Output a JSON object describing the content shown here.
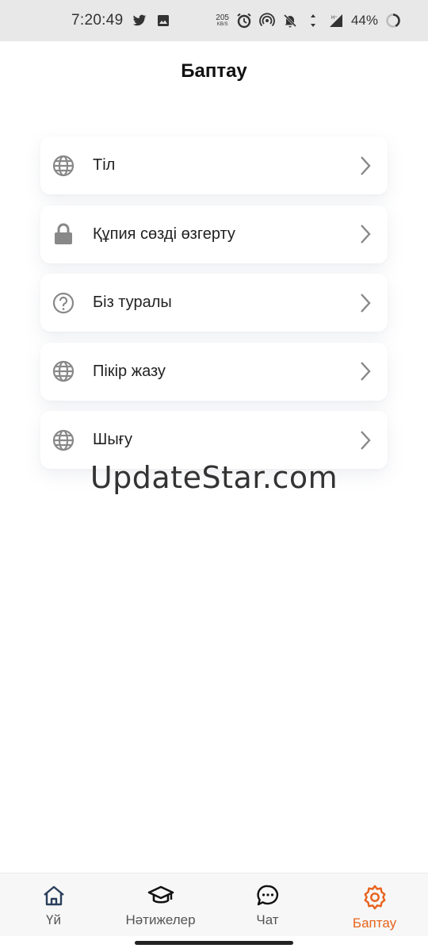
{
  "status_bar": {
    "time": "7:20:49",
    "net_speed": "205",
    "net_unit": "KB/S",
    "battery": "44%"
  },
  "header": {
    "title": "Баптау"
  },
  "menu": {
    "items": [
      {
        "label": "Тіл",
        "icon": "globe-icon"
      },
      {
        "label": "Құпия сөзді өзгерту",
        "icon": "lock-icon"
      },
      {
        "label": "Біз туралы",
        "icon": "help-circle-icon"
      },
      {
        "label": "Пікір жазу",
        "icon": "globe-icon"
      },
      {
        "label": "Шығу",
        "icon": "globe-icon"
      }
    ]
  },
  "watermark": "UpdateStar.com",
  "bottom_nav": {
    "items": [
      {
        "label": "Үй",
        "icon": "home-icon"
      },
      {
        "label": "Нәтижелер",
        "icon": "graduation-cap-icon"
      },
      {
        "label": "Чат",
        "icon": "chat-bubble-icon"
      },
      {
        "label": "Баптау",
        "icon": "gear-icon",
        "active": true
      }
    ]
  },
  "colors": {
    "accent": "#e8641e",
    "icon_gray": "#888888",
    "status_bar_bg": "#e8e8e8"
  }
}
